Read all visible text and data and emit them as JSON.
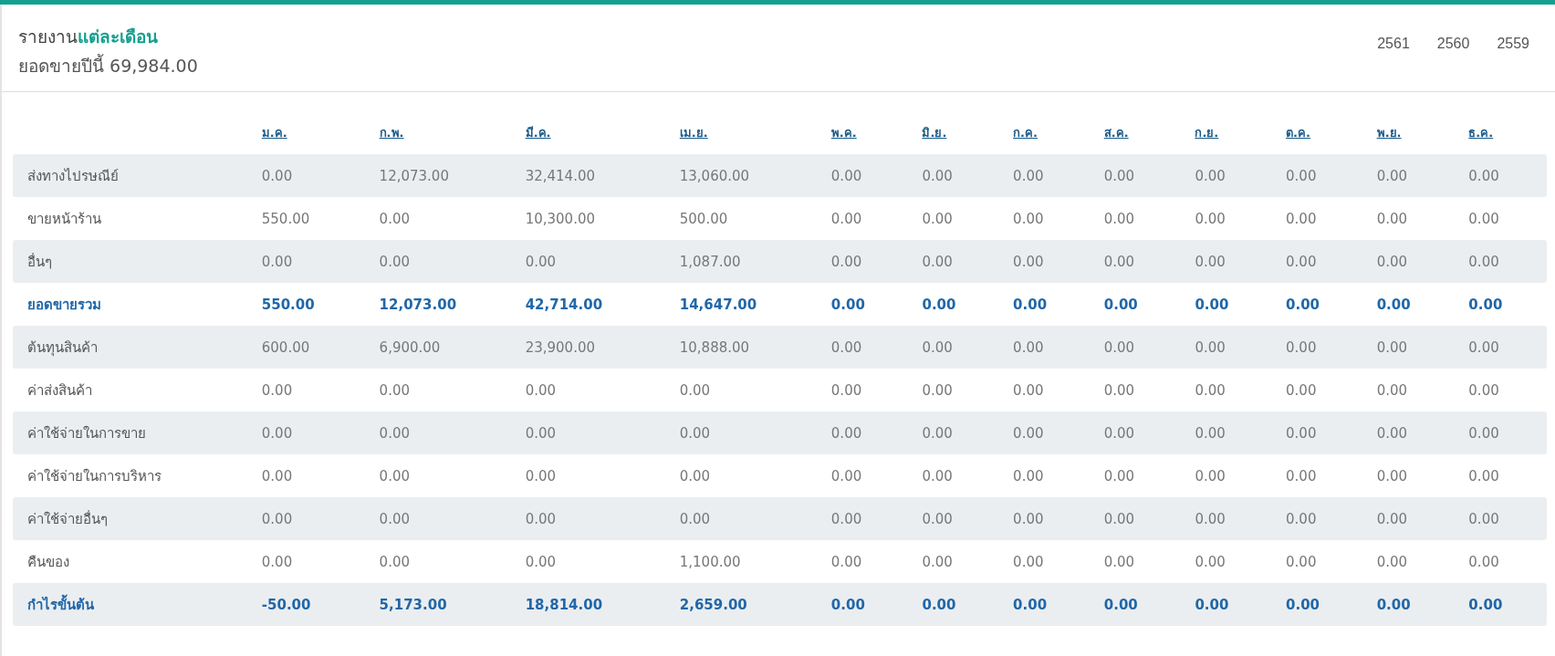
{
  "header": {
    "title": "รายงาน",
    "title_highlight": "แต่ละเดือน",
    "subtitle": "ยอดขายปีนี้ 69,984.00",
    "years": [
      "2561",
      "2560",
      "2559"
    ]
  },
  "table": {
    "columns": [
      "ม.ค.",
      "ก.พ.",
      "มี.ค.",
      "เม.ย.",
      "พ.ค.",
      "มิ.ย.",
      "ก.ค.",
      "ส.ค.",
      "ก.ย.",
      "ต.ค.",
      "พ.ย.",
      "ธ.ค."
    ],
    "rows": [
      {
        "kind": "normal",
        "label": "ส่งทางไปรษณีย์",
        "cells": [
          "0.00",
          "12,073.00",
          "32,414.00",
          "13,060.00",
          "0.00",
          "0.00",
          "0.00",
          "0.00",
          "0.00",
          "0.00",
          "0.00",
          "0.00"
        ]
      },
      {
        "kind": "normal",
        "label": "ขายหน้าร้าน",
        "cells": [
          "550.00",
          "0.00",
          "10,300.00",
          "500.00",
          "0.00",
          "0.00",
          "0.00",
          "0.00",
          "0.00",
          "0.00",
          "0.00",
          "0.00"
        ]
      },
      {
        "kind": "normal",
        "label": "อื่นๆ",
        "cells": [
          "0.00",
          "0.00",
          "0.00",
          "1,087.00",
          "0.00",
          "0.00",
          "0.00",
          "0.00",
          "0.00",
          "0.00",
          "0.00",
          "0.00"
        ]
      },
      {
        "kind": "total",
        "label": "ยอดขายรวม",
        "cells": [
          "550.00",
          "12,073.00",
          "42,714.00",
          "14,647.00",
          "0.00",
          "0.00",
          "0.00",
          "0.00",
          "0.00",
          "0.00",
          "0.00",
          "0.00"
        ]
      },
      {
        "kind": "normal",
        "label": "ต้นทุนสินค้า",
        "cells": [
          "600.00",
          "6,900.00",
          "23,900.00",
          "10,888.00",
          "0.00",
          "0.00",
          "0.00",
          "0.00",
          "0.00",
          "0.00",
          "0.00",
          "0.00"
        ]
      },
      {
        "kind": "normal",
        "label": "ค่าส่งสินค้า",
        "cells": [
          "0.00",
          "0.00",
          "0.00",
          "0.00",
          "0.00",
          "0.00",
          "0.00",
          "0.00",
          "0.00",
          "0.00",
          "0.00",
          "0.00"
        ]
      },
      {
        "kind": "normal",
        "label": "ค่าใช้จ่ายในการขาย",
        "cells": [
          "0.00",
          "0.00",
          "0.00",
          "0.00",
          "0.00",
          "0.00",
          "0.00",
          "0.00",
          "0.00",
          "0.00",
          "0.00",
          "0.00"
        ]
      },
      {
        "kind": "normal",
        "label": "ค่าใช้จ่ายในการบริหาร",
        "cells": [
          "0.00",
          "0.00",
          "0.00",
          "0.00",
          "0.00",
          "0.00",
          "0.00",
          "0.00",
          "0.00",
          "0.00",
          "0.00",
          "0.00"
        ]
      },
      {
        "kind": "normal",
        "label": "ค่าใช้จ่ายอื่นๆ",
        "cells": [
          "0.00",
          "0.00",
          "0.00",
          "0.00",
          "0.00",
          "0.00",
          "0.00",
          "0.00",
          "0.00",
          "0.00",
          "0.00",
          "0.00"
        ]
      },
      {
        "kind": "normal",
        "label": "คืนของ",
        "cells": [
          "0.00",
          "0.00",
          "0.00",
          "1,100.00",
          "0.00",
          "0.00",
          "0.00",
          "0.00",
          "0.00",
          "0.00",
          "0.00",
          "0.00"
        ]
      },
      {
        "kind": "total",
        "label": "กำไรขั้นต้น",
        "cells": [
          "-50.00",
          "5,173.00",
          "18,814.00",
          "2,659.00",
          "0.00",
          "0.00",
          "0.00",
          "0.00",
          "0.00",
          "0.00",
          "0.00",
          "0.00"
        ]
      }
    ]
  }
}
